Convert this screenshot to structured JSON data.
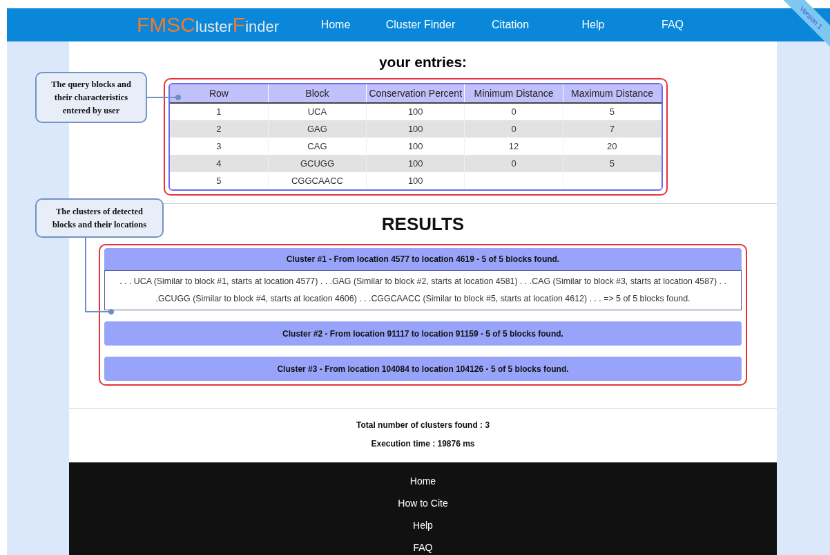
{
  "header": {
    "logo": [
      {
        "text": "FMSC",
        "accent": true
      },
      {
        "text": "luster",
        "accent": false
      },
      {
        "text": "F",
        "accent": true
      },
      {
        "text": "inder",
        "accent": false
      }
    ],
    "nav": [
      "Home",
      "Cluster Finder",
      "Citation",
      "Help",
      "FAQ"
    ],
    "ribbon": "Version 1"
  },
  "entries": {
    "title": "your entries:",
    "columns": [
      "Row",
      "Block",
      "Conservation Percent",
      "Minimum Distance",
      "Maximum Distance"
    ],
    "rows": [
      [
        "1",
        "UCA",
        "100",
        "0",
        "5"
      ],
      [
        "2",
        "GAG",
        "100",
        "0",
        "7"
      ],
      [
        "3",
        "CAG",
        "100",
        "12",
        "20"
      ],
      [
        "4",
        "GCUGG",
        "100",
        "0",
        "5"
      ],
      [
        "5",
        "CGGCAACC",
        "100",
        "",
        ""
      ]
    ]
  },
  "results": {
    "title": "RESULTS",
    "clusters": [
      {
        "header": "Cluster #1 - From location 4577 to location 4619 - 5 of 5 blocks found.",
        "expanded": true,
        "details": ". . . UCA (Similar to block #1, starts at location 4577) . . .GAG (Similar to block #2, starts at location 4581) . . .CAG (Similar to block #3, starts at location 4587) . . .GCUGG (Similar to block #4, starts at location 4606) . . .CGGCAACC (Similar to block #5, starts at location 4612) . . . => 5 of 5 blocks found."
      },
      {
        "header": "Cluster #2 - From location 91117 to location 91159 - 5 of 5 blocks found.",
        "expanded": false
      },
      {
        "header": "Cluster #3 - From location 104084 to location 104126 - 5 of 5 blocks found.",
        "expanded": false
      }
    ]
  },
  "summary": [
    "Total number of clusters found : 3",
    "Execution time : 19876 ms"
  ],
  "footer": [
    "Home",
    "How to Cite",
    "Help",
    "FAQ"
  ],
  "annotations": [
    {
      "text": "The query blocks and their characteristics entered by user"
    },
    {
      "text": "The clusters of detected blocks and their locations"
    }
  ]
}
